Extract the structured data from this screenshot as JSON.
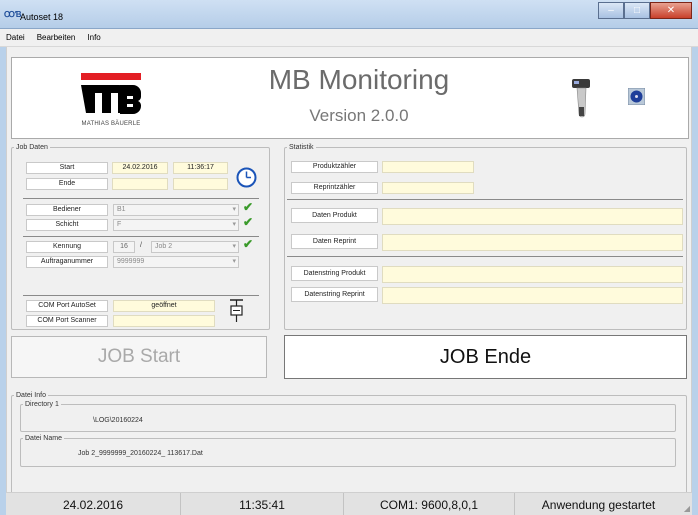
{
  "window": {
    "title": "Autoset 18",
    "app_icon_text": "ꝎƁ"
  },
  "menu": [
    "Datei",
    "Bearbeiten",
    "Info"
  ],
  "header": {
    "logo_tagline": "MATHIAS BÄUERLE",
    "title": "MB Monitoring",
    "version": "Version 2.0.0"
  },
  "job_daten": {
    "legend": "Job Daten",
    "start_label": "Start",
    "start_date": "24.02.2016",
    "start_time": "11:36:17",
    "ende_label": "Ende",
    "ende_date": "",
    "ende_time": "",
    "bediener_label": "Bediener",
    "bediener_value": "B1",
    "schicht_label": "Schicht",
    "schicht_value": "F",
    "kennung_label": "Kennung",
    "kennung_number": "16",
    "kennung_slash": "/",
    "kennung_job": "Job 2",
    "auftrag_label": "Auftraganummer",
    "auftrag_value": "9999999",
    "com_autoset_label": "COM Port AutoSet",
    "com_autoset_status": "geöffnet",
    "com_scanner_label": "COM Port Scanner",
    "com_scanner_status": ""
  },
  "statistik": {
    "legend": "Statistik",
    "produkt_label": "Produktzähler",
    "produkt_value": "",
    "reprint_label": "Reprintzähler",
    "reprint_value": "",
    "daten_produkt_label": "Daten Produkt",
    "daten_produkt_value": "",
    "daten_reprint_label": "Daten Reprint",
    "daten_reprint_value": "",
    "datenstring_produkt_label": "Datenstring Produkt",
    "datenstring_produkt_value": "",
    "datenstring_reprint_label": "Datenstring Reprint",
    "datenstring_reprint_value": ""
  },
  "buttons": {
    "job_start": "JOB Start",
    "job_ende": "JOB Ende"
  },
  "datei_info": {
    "legend": "Datei Info",
    "directory_legend": "Directory 1",
    "directory_value": "\\LOG\\20160224",
    "name_legend": "Datei Name",
    "name_value": "Job 2_9999999_20160224_ 113617.Dat"
  },
  "status_bar": {
    "date": "24.02.2016",
    "time": "11:35:41",
    "com": "COM1: 9600,8,0,1",
    "message": "Anwendung gestartet"
  },
  "colors": {
    "accent_red": "#e31e24",
    "check_green": "#3a9a2a",
    "field_yellow": "#fffbdc"
  },
  "icons": [
    "app-icon",
    "clock-icon",
    "scanner-icon",
    "disk-icon",
    "checkmark-icon",
    "serial-port-icon",
    "dropdown-arrow-icon"
  ]
}
